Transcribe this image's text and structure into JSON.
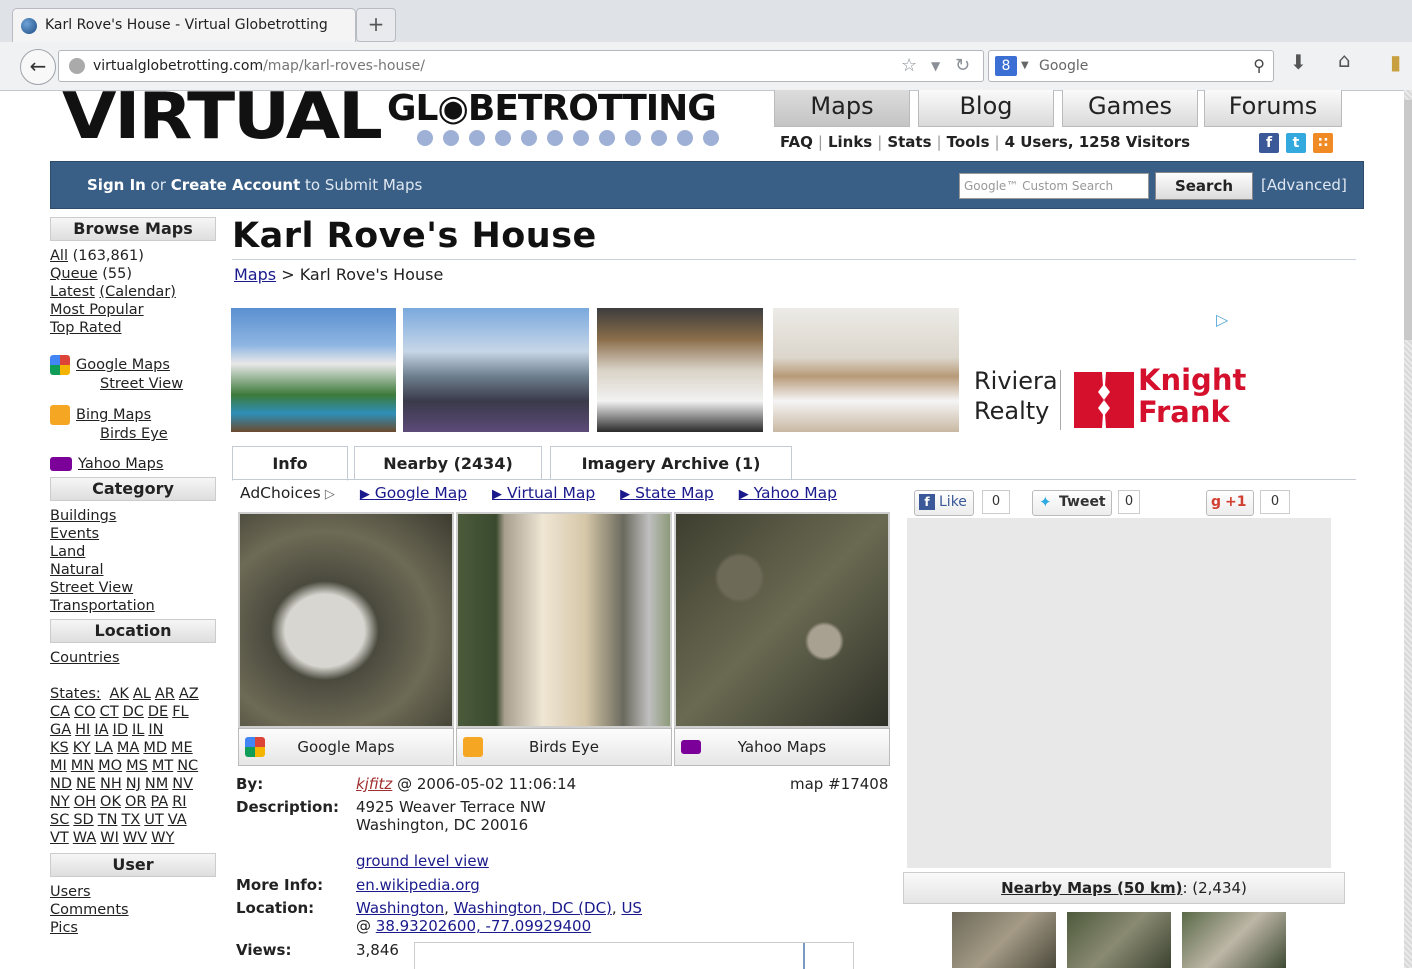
{
  "browser": {
    "tab_title": "Karl Rove's House - Virtual Globetrotting",
    "new_tab": "+",
    "url_domain": "virtualglobetrotting.com",
    "url_path": "/map/karl-roves-house/",
    "search_placeholder": "Google",
    "search_engine_letter": "8"
  },
  "site": {
    "logo_virtual": "VIRTUAL",
    "logo_globe": "GL◉BETROTTING",
    "nav": [
      "Maps",
      "Blog",
      "Games",
      "Forums"
    ],
    "sublinks": [
      "FAQ",
      "Links",
      "Stats",
      "Tools",
      "4 Users, 1258 Visitors"
    ],
    "signin": "Sign In",
    "or": "or",
    "create": "Create Account",
    "signin_suffix": "to Submit Maps",
    "custom_search": "Google™ Custom Search",
    "search_button": "Search",
    "advanced": "[Advanced]"
  },
  "sidebar": {
    "browse_title": "Browse Maps",
    "all": "All",
    "all_count": "(163,861)",
    "queue": "Queue",
    "queue_count": "(55)",
    "latest": "Latest",
    "calendar": "(Calendar)",
    "popular": "Most Popular",
    "top": "Top Rated",
    "google_maps": "Google Maps",
    "street_view": "Street View",
    "bing_maps": "Bing Maps",
    "birds_eye": "Birds Eye",
    "yahoo_maps": "Yahoo Maps",
    "category_title": "Category",
    "categories": [
      "Buildings",
      "Events",
      "Land",
      "Natural",
      "Street View",
      "Transportation"
    ],
    "location_title": "Location",
    "countries": "Countries",
    "states_label": "States:",
    "states_rows": [
      [
        "AK",
        "AL",
        "AR",
        "AZ"
      ],
      [
        "CA",
        "CO",
        "CT",
        "DC",
        "DE",
        "FL"
      ],
      [
        "GA",
        "HI",
        "IA",
        "ID",
        "IL",
        "IN"
      ],
      [
        "KS",
        "KY",
        "LA",
        "MA",
        "MD",
        "ME"
      ],
      [
        "MI",
        "MN",
        "MO",
        "MS",
        "MT",
        "NC"
      ],
      [
        "ND",
        "NE",
        "NH",
        "NJ",
        "NM",
        "NV"
      ],
      [
        "NY",
        "OH",
        "OK",
        "OR",
        "PA",
        "RI"
      ],
      [
        "SC",
        "SD",
        "TN",
        "TX",
        "UT",
        "VA"
      ],
      [
        "VT",
        "WA",
        "WI",
        "WV",
        "WY"
      ]
    ],
    "user_title": "User",
    "users": "Users",
    "comments": "Comments",
    "pics": "Pics"
  },
  "main": {
    "title": "Karl Rove's House",
    "crumb_link": "Maps",
    "crumb_sep": ">",
    "crumb_current": "Karl Rove's House",
    "ad_line1": "Riviera",
    "ad_line2": "Realty",
    "ad_brand1": "Knight",
    "ad_brand2": "Frank",
    "tabs": [
      "Info",
      "Nearby (2434)",
      "Imagery Archive (1)"
    ],
    "adchoices": "AdChoices",
    "ad_links": [
      "Google Map",
      "Virtual Map",
      "State Map",
      "Yahoo Map"
    ],
    "sat_buttons": [
      "Google Maps",
      "Birds Eye",
      "Yahoo Maps"
    ],
    "by_label": "By:",
    "by_user": "kjfitz",
    "by_date": "@ 2006-05-02 11:06:14",
    "map_number": "map #17408",
    "desc_label": "Description:",
    "desc_line1": "4925 Weaver Terrace NW",
    "desc_line2": "Washington, DC 20016",
    "ground_link": "ground level view",
    "more_label": "More Info:",
    "more_link": "en.wikipedia.org",
    "loc_label": "Location:",
    "loc_links": [
      "Washington",
      "Washington, DC (DC)",
      "US"
    ],
    "coords_prefix": "@",
    "coords": "38.93202600, -77.09929400",
    "views_label": "Views:",
    "views": "3,846"
  },
  "right": {
    "like": "Like",
    "like_count": "0",
    "tweet": "Tweet",
    "tweet_count": "0",
    "plus": "+1",
    "plus_count": "0",
    "nearby_link": "Nearby Maps (50 km)",
    "nearby_count": ": (2,434)"
  },
  "colors": {
    "bluebar": "#3a5f86",
    "link": "#1a1a8c",
    "knight_frank": "#d4102d"
  }
}
